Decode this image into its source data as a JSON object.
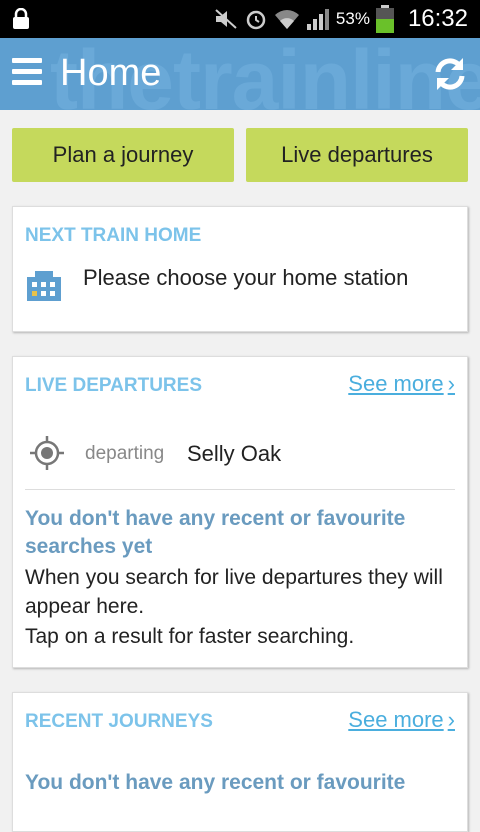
{
  "status_bar": {
    "battery_percent": "53%",
    "time": "16:32"
  },
  "app_bar": {
    "watermark": "thetrainline",
    "title": "Home"
  },
  "tabs": {
    "plan": "Plan a journey",
    "live": "Live departures"
  },
  "next_train": {
    "heading": "NEXT TRAIN HOME",
    "message": "Please choose your home station"
  },
  "live_departures": {
    "heading": "LIVE DEPARTURES",
    "see_more": "See more",
    "departing_label": "departing",
    "station": "Selly Oak",
    "empty_title": "You don't have any recent or favourite searches yet",
    "empty_body": "When you search for live departures they will appear here.",
    "empty_tip": "Tap on a result for faster searching."
  },
  "recent_journeys": {
    "heading": "RECENT JOURNEYS",
    "see_more": "See more",
    "empty_title": "You don't have any recent or favourite"
  },
  "colors": {
    "app_bar": "#5e9fd0",
    "tab": "#c5d95c",
    "heading": "#7cc3ea",
    "link": "#4aaede",
    "empty_title": "#6a9bbf"
  }
}
